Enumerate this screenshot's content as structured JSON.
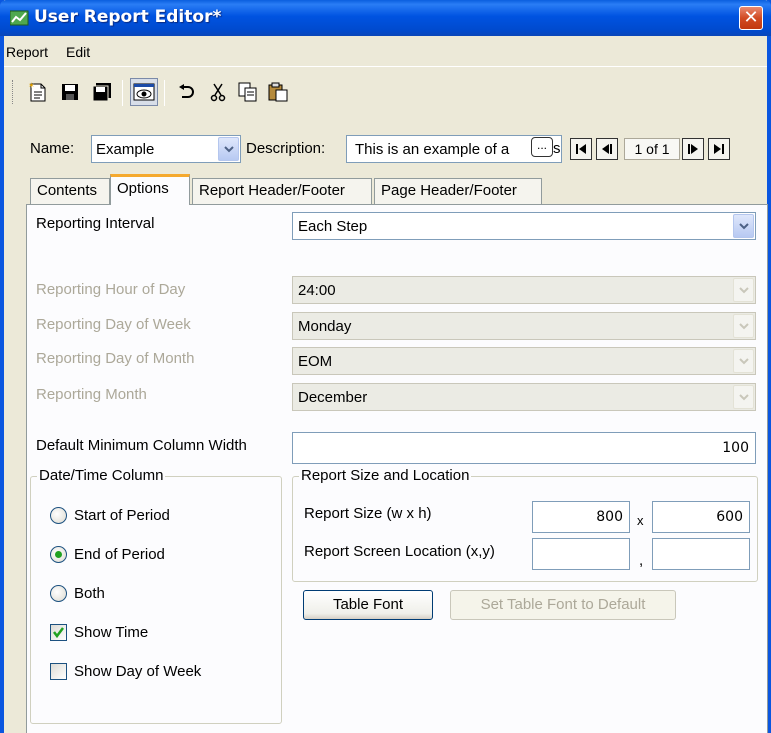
{
  "window": {
    "title": "User Report Editor*",
    "close_glyph": "✕"
  },
  "menu": [
    "Report",
    "Edit"
  ],
  "toolbar": {
    "icons": [
      "new-report-icon",
      "save-icon",
      "save-as-icon",
      "preview-icon",
      "undo-icon",
      "cut-icon",
      "copy-icon",
      "paste-icon"
    ]
  },
  "header": {
    "name_label": "Name:",
    "name_value": "Example",
    "description_label": "Description:",
    "description_value": "This is an example of a",
    "description_tail": "s",
    "ellipsis": "...",
    "page_indicator": "1 of 1"
  },
  "tabs": [
    {
      "label": "Contents",
      "active": false
    },
    {
      "label": "Options",
      "active": true
    },
    {
      "label": "Report Header/Footer",
      "active": false
    },
    {
      "label": "Page Header/Footer",
      "active": false
    }
  ],
  "options": {
    "reporting_interval": {
      "label": "Reporting Interval",
      "value": "Each Step"
    },
    "hour_of_day": {
      "label": "Reporting Hour of Day",
      "value": "24:00"
    },
    "day_of_week": {
      "label": "Reporting Day of Week",
      "value": "Monday"
    },
    "day_of_month": {
      "label": "Reporting Day of Month",
      "value": "EOM"
    },
    "month": {
      "label": "Reporting Month",
      "value": "December"
    },
    "min_col_width": {
      "label": "Default Minimum Column Width",
      "value": "100"
    }
  },
  "datetime_group": {
    "title": "Date/Time Column",
    "start_of_period": "Start of Period",
    "end_of_period": "End of Period",
    "both": "Both",
    "show_time": "Show Time",
    "show_day_of_week": "Show Day of Week"
  },
  "size_group": {
    "title": "Report Size and Location",
    "size_label": "Report Size (w x h)",
    "width": "800",
    "x_sep": "x",
    "height": "600",
    "location_label": "Report Screen Location (x,y)",
    "loc_x": "",
    "loc_y": "",
    "comma_sep": ","
  },
  "buttons": {
    "table_font": "Table Font",
    "set_default_font": "Set Table Font to Default"
  },
  "colors": {
    "titlebar": "#0053e1",
    "tab_highlight": "#f5a92e",
    "radio_selected": "#21a121"
  }
}
